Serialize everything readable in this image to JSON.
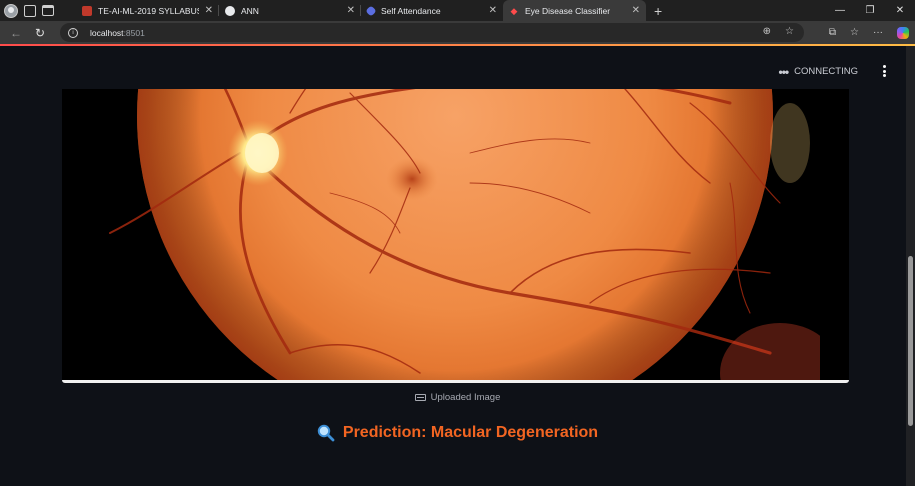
{
  "browser": {
    "tabs": [
      {
        "title": "TE-AI-ML-2019 SYLLABUS_17012...",
        "favicon": "pdf-icon",
        "color": "#c0392b",
        "active": false
      },
      {
        "title": "ANN",
        "favicon": "circle-icon",
        "color": "#e8eaed",
        "active": false
      },
      {
        "title": "Self Attendance",
        "favicon": "hexagon-icon",
        "color": "#5b6ee1",
        "active": false
      },
      {
        "title": "Eye Disease Classifier",
        "favicon": "streamlit-icon",
        "color": "#ff4b4b",
        "active": true
      }
    ],
    "url_host": "localhost",
    "url_port": ":8501"
  },
  "app": {
    "status_text": "CONNECTING",
    "image_caption": "Uploaded Image",
    "prediction_icon": "magnifying-glass-icon",
    "prediction_text": "Prediction: Macular Degeneration",
    "accent_color": "#f26522"
  }
}
